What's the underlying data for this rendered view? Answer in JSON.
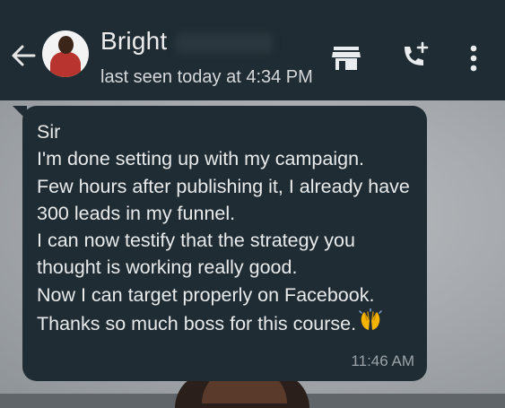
{
  "contact": {
    "name": "Bright",
    "last_seen": "last seen today at 4:34 PM"
  },
  "header_icons": [
    "back-arrow-icon",
    "catalog-store-icon",
    "add-call-icon",
    "more-vert-icon"
  ],
  "message": {
    "lines": [
      "Sir",
      "I'm done setting up with my campaign.",
      "Few hours after publishing it, I already have",
      "300 leads in my funnel.",
      "I can now testify that the strategy you",
      "thought is working really good.",
      "Now I can target properly on Facebook.",
      "Thanks so much boss for this course."
    ],
    "emoji": "raising-hands",
    "time": "11:46 AM"
  },
  "colors": {
    "header_bg": "#1f2c33",
    "bubble_bg": "#202c33",
    "text": "#e8ebec",
    "timestamp": "#9aa3a8"
  }
}
